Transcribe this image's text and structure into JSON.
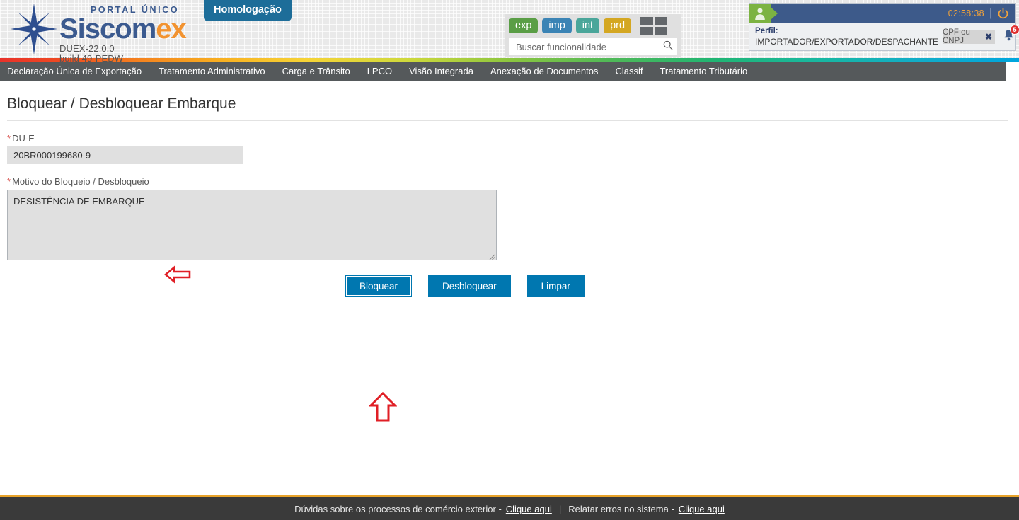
{
  "header": {
    "brand": {
      "portal": "PORTAL ÚNICO",
      "name_part1": "Siscom",
      "name_part2": "ex",
      "version": "DUEX-22.0.0",
      "build": "build 49-PEDW",
      "star_icon": "compass-rose-icon"
    },
    "environment_badge": "Homologação",
    "env_buttons": [
      {
        "label": "exp",
        "color": "#5a9e46"
      },
      {
        "label": "imp",
        "color": "#3b84b5"
      },
      {
        "label": "int",
        "color": "#4aa69a"
      },
      {
        "label": "prd",
        "color": "#d4a722"
      }
    ],
    "apps_grid_icon": "grid-apps-icon",
    "search": {
      "placeholder": "Buscar funcionalidade",
      "value": "",
      "icon": "search-icon"
    },
    "profile": {
      "avatar_icon": "user-avatar-icon",
      "session_timer": "02:58:38",
      "logout_icon": "power-icon",
      "perfil_label": "Perfil:",
      "perfil_value": "IMPORTADOR/EXPORTADOR/DESPACHANTE",
      "cpf_placeholder": "CPF ou CNPJ",
      "cpf_value": "",
      "clear_icon": "close-x-icon",
      "bell_icon": "notification-bell-icon",
      "bell_count": "5"
    }
  },
  "nav": {
    "items": [
      "Declaração Única de Exportação",
      "Tratamento Administrativo",
      "Carga e Trânsito",
      "LPCO",
      "Visão Integrada",
      "Anexação de Documentos",
      "Classif",
      "Tratamento Tributário"
    ]
  },
  "main": {
    "page_title": "Bloquear / Desbloquear Embarque",
    "required_marker": "*",
    "due": {
      "label": "DU-E",
      "value": "20BR000199680-9"
    },
    "motivo": {
      "label": "Motivo do Bloqueio / Desbloqueio",
      "value": "DESISTÊNCIA DE EMBARQUE"
    },
    "buttons": [
      {
        "label": "Bloquear",
        "focused": true
      },
      {
        "label": "Desbloquear",
        "focused": false
      },
      {
        "label": "Limpar",
        "focused": false
      }
    ],
    "annotations": [
      {
        "name": "arrow-left-motivo",
        "direction": "left"
      },
      {
        "name": "arrow-up-bloquear",
        "direction": "up"
      }
    ]
  },
  "footer": {
    "text_duvidas": "Dúvidas sobre os processos de comércio exterior -",
    "link_duvidas": "Clique aqui",
    "separator": "|",
    "text_erros": "Relatar erros no sistema -",
    "link_erros": "Clique aqui"
  },
  "colors": {
    "accent_blue": "#0077b0",
    "brand_blue": "#3b5a8f",
    "brand_orange": "#f29330",
    "nav_gray": "#55595b",
    "footer_dark": "#3a3a3a",
    "footer_rule": "#e8a32a",
    "annotation_red": "#e01f26"
  }
}
